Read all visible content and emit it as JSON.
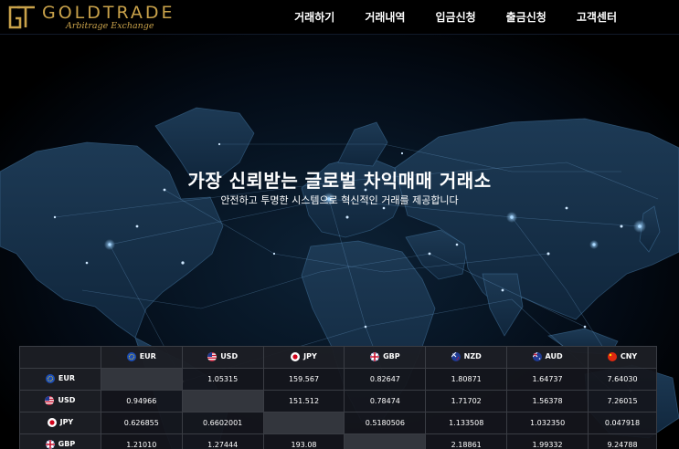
{
  "brand": {
    "name": "GOLDTRADE",
    "tagline": "Arbitrage Exchange",
    "gold_color": "#c9a24a"
  },
  "nav": {
    "items": [
      "거래하기",
      "거래내역",
      "입금신청",
      "출금신청",
      "고객센터"
    ]
  },
  "hero": {
    "title": "가장 신뢰받는 글로벌 차익매매 거래소",
    "subtitle": "안전하고 투명한 시스템으로 혁신적인 거래를 제공합니다"
  },
  "rates": {
    "columns": [
      {
        "code": "EUR",
        "flag": "eu-flag-icon"
      },
      {
        "code": "USD",
        "flag": "us-flag-icon"
      },
      {
        "code": "JPY",
        "flag": "jp-flag-icon"
      },
      {
        "code": "GBP",
        "flag": "gb-flag-icon"
      },
      {
        "code": "NZD",
        "flag": "nz-flag-icon"
      },
      {
        "code": "AUD",
        "flag": "au-flag-icon"
      },
      {
        "code": "CNY",
        "flag": "cn-flag-icon"
      }
    ],
    "rows": [
      {
        "code": "EUR",
        "flag": "eu-flag-icon",
        "values": [
          "",
          "1.05315",
          "159.567",
          "0.82647",
          "1.80871",
          "1.64737",
          "7.64030"
        ]
      },
      {
        "code": "USD",
        "flag": "us-flag-icon",
        "values": [
          "0.94966",
          "",
          "151.512",
          "0.78474",
          "1.71702",
          "1.56378",
          "7.26015"
        ]
      },
      {
        "code": "JPY",
        "flag": "jp-flag-icon",
        "values": [
          "0.626855",
          "0.6602001",
          "",
          "0.5180506",
          "1.133508",
          "1.032350",
          "0.047918"
        ]
      },
      {
        "code": "GBP",
        "flag": "gb-flag-icon",
        "values": [
          "1.21010",
          "1.27444",
          "193.08",
          "",
          "2.18861",
          "1.99332",
          "9.24788"
        ]
      }
    ]
  }
}
